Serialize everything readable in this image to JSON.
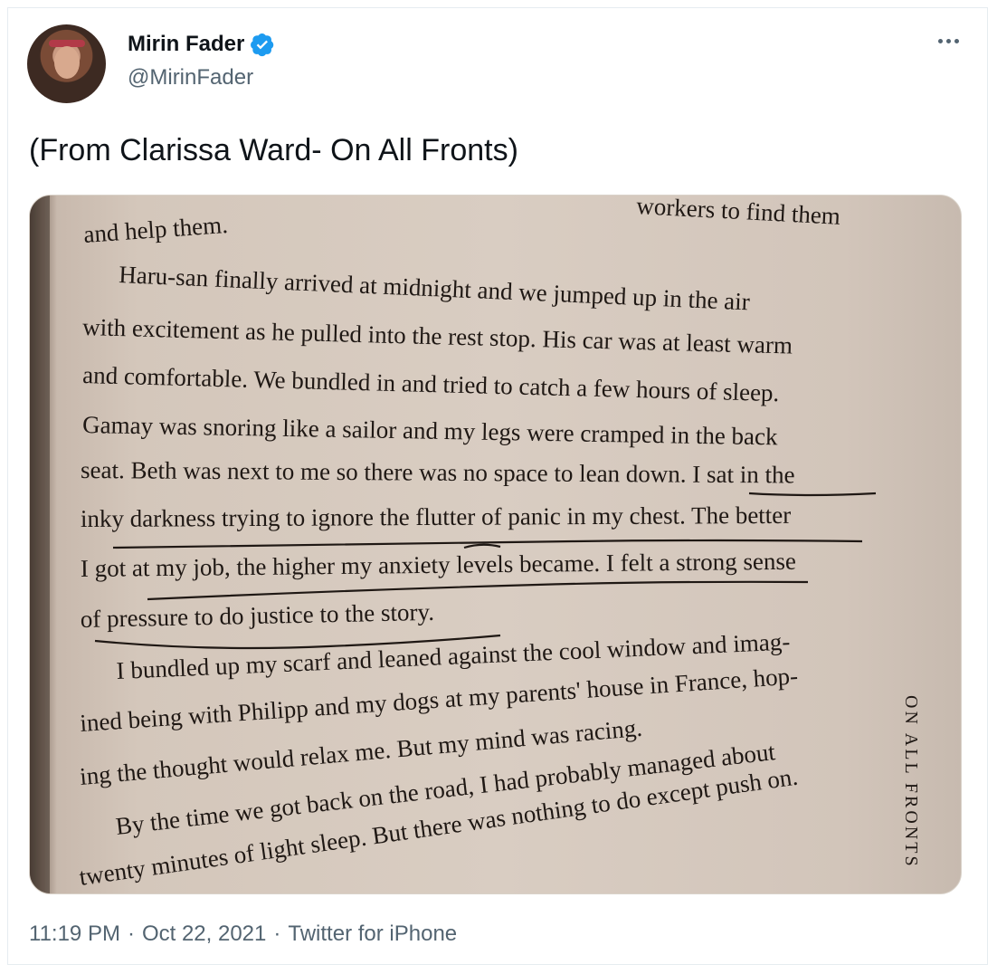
{
  "author": {
    "name": "Mirin Fader",
    "handle": "@MirinFader",
    "verified_color": "#1d9bf0"
  },
  "tweet": {
    "text": "(From Clarissa Ward- On All Fronts)"
  },
  "photo": {
    "lines": [
      "workers to find them",
      "and help them.",
      "Haru-san finally arrived at midnight and we jumped up in the air",
      "with excitement as he pulled into the rest stop. His car was at least warm",
      "and comfortable. We bundled in and tried to catch a few hours of sleep.",
      "Gamay was snoring like a sailor and my legs were cramped in the back",
      "seat. Beth was next to me so there was no space to lean down. I sat in the",
      "inky darkness trying to ignore the flutter of panic in my chest. The better",
      "I got at my job, the higher my anxiety levels became. I felt a strong sense",
      "of pressure to do justice to the story.",
      "I bundled up my scarf and leaned against the cool window and imag-",
      "ined being with Philipp and my dogs at my parents' house in France, hop-",
      "ing the thought would relax me. But my mind was racing.",
      "By the time we got back on the road, I had probably managed about",
      "twenty minutes of light sleep. But there was nothing to do except push on."
    ],
    "running_head": "ON ALL FRONTS"
  },
  "meta": {
    "time": "11:19 PM",
    "dot": "·",
    "date": "Oct 22, 2021",
    "source": "Twitter for iPhone"
  }
}
